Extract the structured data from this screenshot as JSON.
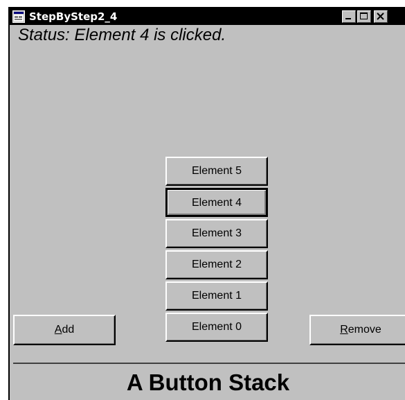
{
  "window": {
    "title": "StepByStep2_4",
    "app_icon": "window-app-icon",
    "controls": {
      "minimize_icon": "minimize-icon",
      "maximize_icon": "maximize-icon",
      "close_icon": "close-icon"
    }
  },
  "status": {
    "text": "Status: Element 4 is clicked."
  },
  "stack": {
    "buttons": [
      {
        "label": "Element 5"
      },
      {
        "label": "Element 4",
        "focused": true
      },
      {
        "label": "Element 3"
      },
      {
        "label": "Element 2"
      },
      {
        "label": "Element 1"
      },
      {
        "label": "Element 0"
      }
    ]
  },
  "actions": {
    "add_label": "Add",
    "remove_label": "Remove"
  },
  "footer": {
    "title": "A Button Stack"
  },
  "colors": {
    "face": "#c0c0c0",
    "titlebar": "#000000",
    "text": "#000000"
  }
}
